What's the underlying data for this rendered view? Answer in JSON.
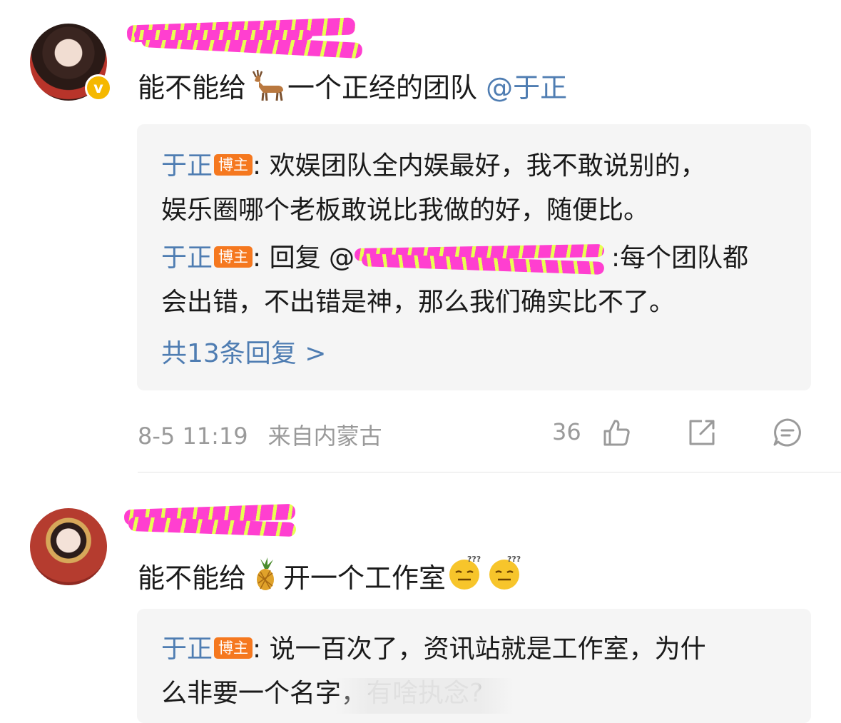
{
  "comments": [
    {
      "text_before": "能不能给",
      "emoji": "deer",
      "text_after": "一个正经的团队 ",
      "mention": "@于正",
      "replies": [
        {
          "name": "于正",
          "tag": "博主",
          "text_l1": ": 欢娱团队全内娱最好，我不敢说别的，",
          "text_l2": "娱乐圈哪个老板敢说比我做的好，随便比。"
        },
        {
          "name": "于正",
          "tag": "博主",
          "text_l1a": ": 回复 @",
          "text_l1b": ":每个团队都",
          "text_l2": "会出错，不出错是神，那么我们确实比不了。"
        }
      ],
      "more": "共13条回复 >",
      "date": "8-5 11:19",
      "location": "来自内蒙古",
      "likes": "36"
    },
    {
      "text_before": "能不能给",
      "emoji": "pineapple",
      "text_after": "开一个工作室",
      "replies": [
        {
          "name": "于正",
          "tag": "博主",
          "text_l1": ": 说一百次了，资讯站就是工作室，为什",
          "text_l2": "么非要一个名字，有啥执念?"
        }
      ]
    }
  ],
  "colors": {
    "link": "#4f7db2",
    "tag": "#f5781f",
    "badge": "#f5b800"
  }
}
